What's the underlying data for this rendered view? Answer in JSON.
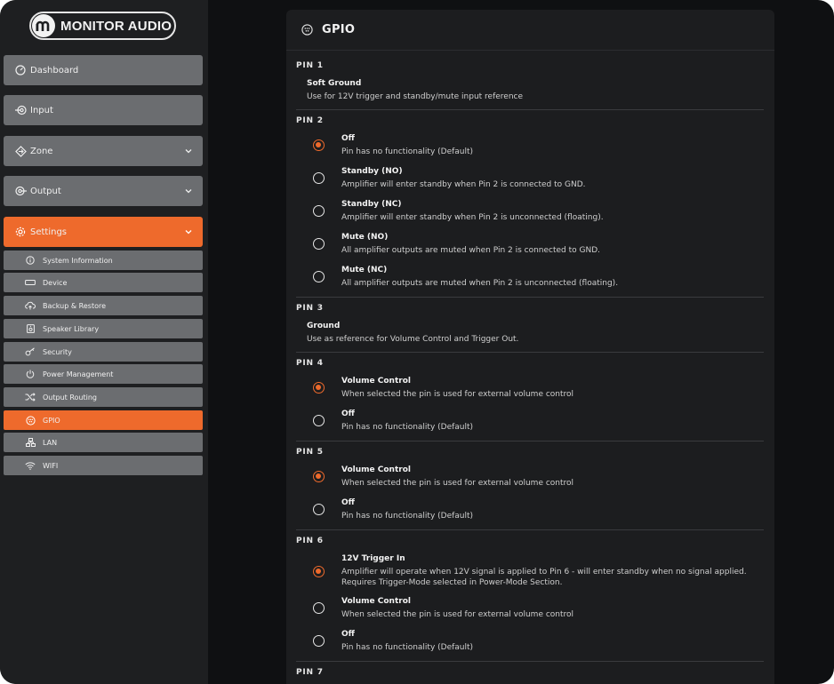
{
  "brand": {
    "name": "MONITOR AUDIO"
  },
  "nav": {
    "main": [
      {
        "label": "Dashboard",
        "icon": "dashboard-icon"
      },
      {
        "label": "Input",
        "icon": "input-icon"
      },
      {
        "label": "Zone",
        "icon": "zone-icon"
      },
      {
        "label": "Output",
        "icon": "output-icon"
      },
      {
        "label": "Settings",
        "icon": "gear-icon"
      }
    ],
    "settings_items": [
      {
        "label": "System Information",
        "icon": "info-icon"
      },
      {
        "label": "Device",
        "icon": "device-icon"
      },
      {
        "label": "Backup & Restore",
        "icon": "cloud-upload-icon"
      },
      {
        "label": "Speaker Library",
        "icon": "speaker-icon"
      },
      {
        "label": "Security",
        "icon": "key-icon"
      },
      {
        "label": "Power Management",
        "icon": "power-icon"
      },
      {
        "label": "Output Routing",
        "icon": "shuffle-icon"
      },
      {
        "label": "GPIO",
        "icon": "gpio-icon"
      },
      {
        "label": "LAN",
        "icon": "lan-icon"
      },
      {
        "label": "WIFI",
        "icon": "wifi-icon"
      }
    ],
    "active_main": "Settings",
    "active_sub": "GPIO"
  },
  "panel": {
    "title": "GPIO",
    "pin1": {
      "label": "PIN 1",
      "title": "Soft Ground",
      "desc": "Use for 12V trigger and standby/mute input reference"
    },
    "pin2": {
      "label": "PIN 2",
      "options": [
        {
          "title": "Off",
          "desc": "Pin has no functionality (Default)",
          "selected": true
        },
        {
          "title": "Standby (NO)",
          "desc": "Amplifier will enter standby when Pin 2 is connected to GND.",
          "selected": false
        },
        {
          "title": "Standby (NC)",
          "desc": "Amplifier will enter standby when Pin 2 is unconnected (floating).",
          "selected": false
        },
        {
          "title": "Mute (NO)",
          "desc": "All amplifier outputs are muted when Pin 2 is connected to GND.",
          "selected": false
        },
        {
          "title": "Mute (NC)",
          "desc": "All amplifier outputs are muted when Pin 2 is unconnected (floating).",
          "selected": false
        }
      ]
    },
    "pin3": {
      "label": "PIN 3",
      "title": "Ground",
      "desc": "Use as reference for Volume Control and Trigger Out."
    },
    "pin4": {
      "label": "PIN 4",
      "options": [
        {
          "title": "Volume Control",
          "desc": "When selected the pin is used for external volume control",
          "selected": true
        },
        {
          "title": "Off",
          "desc": "Pin has no functionality (Default)",
          "selected": false
        }
      ]
    },
    "pin5": {
      "label": "PIN 5",
      "options": [
        {
          "title": "Volume Control",
          "desc": "When selected the pin is used for external volume control",
          "selected": true
        },
        {
          "title": "Off",
          "desc": "Pin has no functionality (Default)",
          "selected": false
        }
      ]
    },
    "pin6": {
      "label": "PIN 6",
      "options": [
        {
          "title": "12V Trigger In",
          "desc": "Amplifier will operate when 12V signal is applied to Pin 6 - will enter standby when no signal applied. Requires Trigger-Mode selected in Power-Mode Section.",
          "selected": true
        },
        {
          "title": "Volume Control",
          "desc": "When selected the pin is used for external volume control",
          "selected": false
        },
        {
          "title": "Off",
          "desc": "Pin has no functionality (Default)",
          "selected": false
        }
      ]
    },
    "pin7": {
      "label": "PIN 7"
    }
  },
  "colors": {
    "accent": "#ee6a2c",
    "nav_item": "#6b6d70",
    "sidebar_bg": "#1e1f21",
    "panel_bg": "#1c1d1f"
  }
}
